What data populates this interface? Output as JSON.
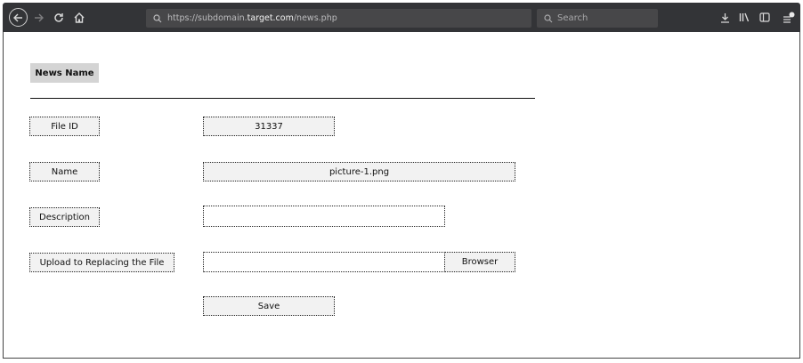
{
  "browser": {
    "url_prefix": "https://subdomain.",
    "url_domain": "target.com",
    "url_path": "/news.php",
    "search_placeholder": "Search"
  },
  "form": {
    "heading": "News Name",
    "file_id_label": "File ID",
    "file_id_value": "31337",
    "name_label": "Name",
    "name_value": "picture-1.png",
    "description_label": "Description",
    "description_value": "",
    "upload_label": "Upload to Replacing the File",
    "upload_value": "",
    "browse_label": "Browser",
    "save_label": "Save"
  }
}
